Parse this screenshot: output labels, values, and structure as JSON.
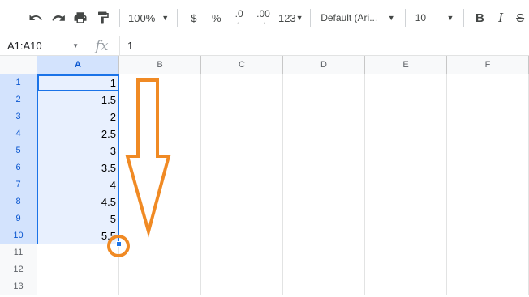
{
  "toolbar": {
    "zoom": "100%",
    "currency": "$",
    "percent": "%",
    "decrease_decimal": ".0",
    "increase_decimal": ".00",
    "more_formats": "123",
    "font_family": "Default (Ari...",
    "font_size": "10",
    "bold": "B",
    "italic": "I",
    "strikethrough": "S"
  },
  "formula_bar": {
    "name_box": "A1:A10",
    "fx": "fx",
    "value": "1"
  },
  "columns": [
    "A",
    "B",
    "C",
    "D",
    "E",
    "F"
  ],
  "rows": [
    "1",
    "2",
    "3",
    "4",
    "5",
    "6",
    "7",
    "8",
    "9",
    "10",
    "11",
    "12",
    "13"
  ],
  "cells_A": [
    "1",
    "1.5",
    "2",
    "2.5",
    "3",
    "3.5",
    "4",
    "4.5",
    "5",
    "5.5"
  ],
  "annotation_color": "#f08a24",
  "selection_color": "#1a73e8"
}
